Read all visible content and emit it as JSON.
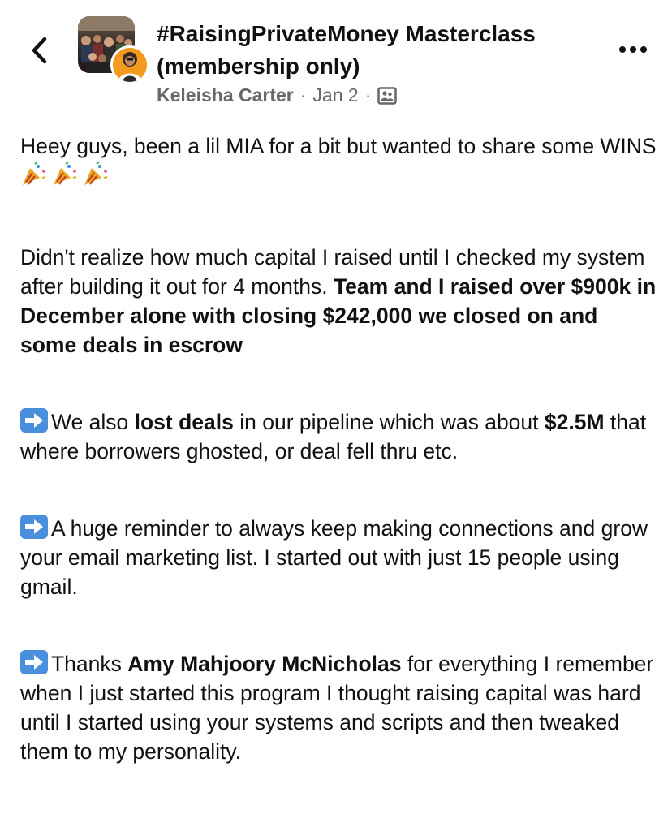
{
  "header": {
    "group_title": "#RaisingPrivateMoney Masterclass (membership only)",
    "author": "Keleisha Carter",
    "separator": "·",
    "date": "Jan 2",
    "audience_icon": "group-audience-icon",
    "back_icon": "chevron-left-icon",
    "more_icon": "more-horizontal-icon"
  },
  "post": {
    "p1": {
      "text": "Heey guys, been a lil MIA for a bit but wanted to share some WINS",
      "emoji": "party-popper-icon"
    },
    "p2": {
      "text": "Didn't realize how much capital I raised until I checked my system after building it out for 4 months.",
      "bold": "Team and I raised over $900k in December alone with closing $242,000 we closed on and some deals in escrow"
    },
    "p3": {
      "pre": "We also ",
      "bold1": "lost deals",
      "mid": " in our pipeline which was about ",
      "bold2": "$2.5M",
      "post": " that where borrowers ghosted, or deal fell thru etc."
    },
    "p4": {
      "text": "A huge reminder to always keep making connections and grow your email marketing list. I started out with just 15 people using gmail."
    },
    "p5": {
      "pre": "Thanks ",
      "bold": "Amy Mahjoory McNicholas",
      "post": " for everything I remember when I just started this program I thought raising capital was hard until I started using your systems and scripts and then tweaked them to my personality."
    }
  },
  "colors": {
    "text": "#111111",
    "meta": "#65676b",
    "arrow_emoji_bg": "#4a8fdd"
  }
}
